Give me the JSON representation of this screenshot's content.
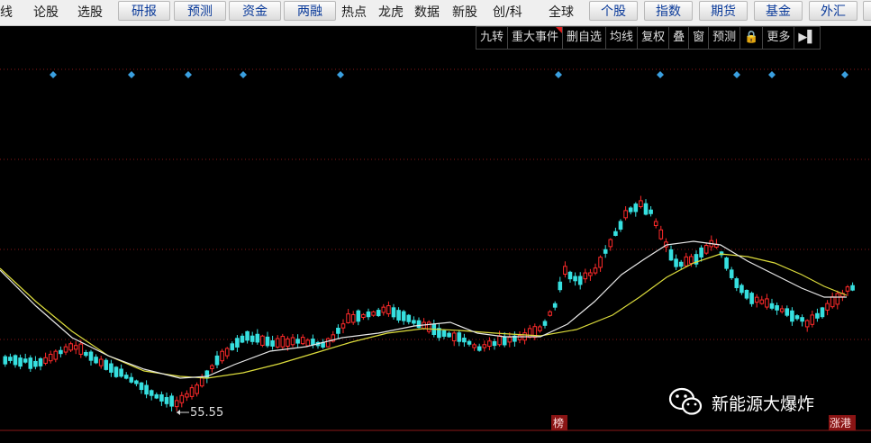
{
  "topbar": {
    "items": [
      {
        "label": "线",
        "kind": "text"
      },
      {
        "label": "论股",
        "kind": "text"
      },
      {
        "label": "选股",
        "kind": "text"
      },
      {
        "label": "研报",
        "kind": "button"
      },
      {
        "label": "预测",
        "kind": "button"
      },
      {
        "label": "资金",
        "kind": "button"
      },
      {
        "label": "两融",
        "kind": "button"
      },
      {
        "label": "热点",
        "kind": "text"
      },
      {
        "label": "龙虎",
        "kind": "text"
      },
      {
        "label": "数据",
        "kind": "text"
      },
      {
        "label": "新股",
        "kind": "text"
      },
      {
        "label": "创/科",
        "kind": "text"
      },
      {
        "label": "全球",
        "kind": "text"
      },
      {
        "label": "个股",
        "kind": "button"
      },
      {
        "label": "指数",
        "kind": "button"
      },
      {
        "label": "期货",
        "kind": "button"
      },
      {
        "label": "基金",
        "kind": "button"
      },
      {
        "label": "外汇",
        "kind": "button"
      }
    ]
  },
  "subbar": {
    "items": [
      {
        "label": "九转",
        "marker": false
      },
      {
        "label": "重大事件",
        "marker": true
      },
      {
        "label": "删自选",
        "marker": false
      },
      {
        "label": "均线",
        "marker": false
      },
      {
        "label": "复权",
        "marker": false
      },
      {
        "label": "叠",
        "marker": false
      },
      {
        "label": "窗",
        "marker": false
      },
      {
        "label": "预测",
        "marker": false
      },
      {
        "label": "🔒",
        "marker": false
      },
      {
        "label": "更多",
        "marker": false
      },
      {
        "label": "▶▌",
        "marker": false
      }
    ]
  },
  "chart_data": {
    "type": "candlestick",
    "low_label": "55.55",
    "badges": [
      "榜",
      "涨港"
    ],
    "colors": {
      "up": "#ff2a2a",
      "down": "#36e0e0",
      "ma_white": "#e8e8e8",
      "ma_yellow": "#dcdc3c",
      "event_marker": "#3aa0e0",
      "grid": "#8a1818"
    },
    "event_marker_count": 11
  },
  "watermark": {
    "text": "新能源大爆炸",
    "icon": "wechat-icon"
  }
}
